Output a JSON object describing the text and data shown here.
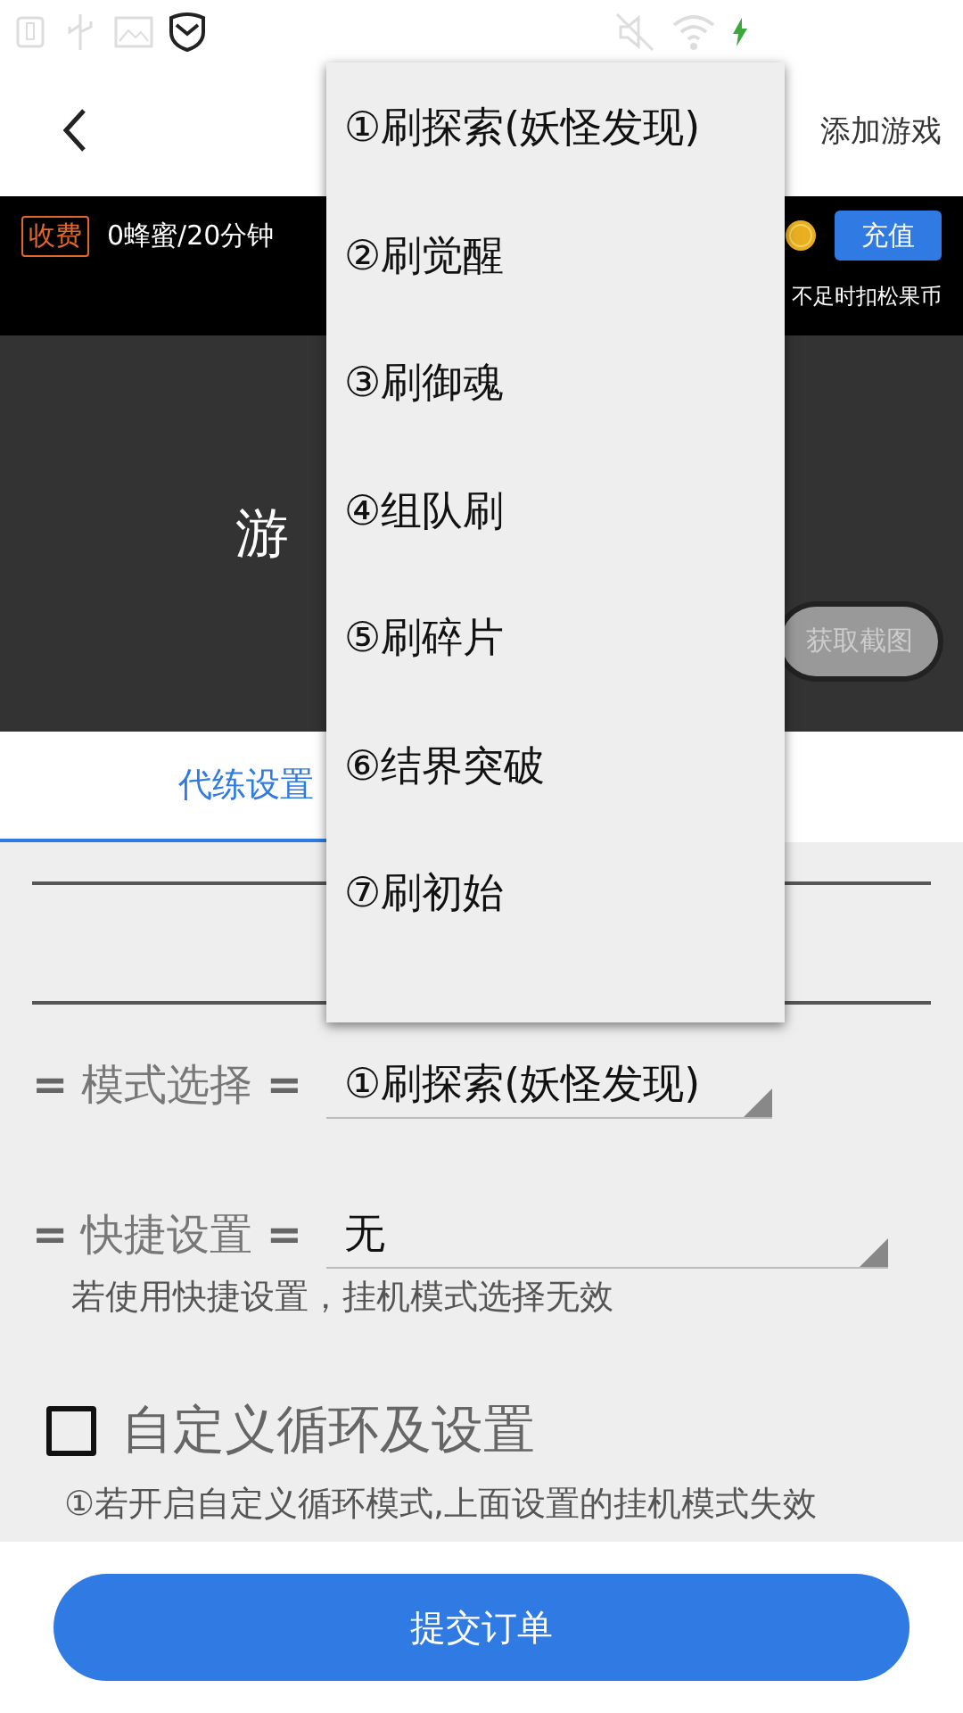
{
  "header": {
    "action": "添加游戏"
  },
  "fee_bar": {
    "tag": "收费",
    "rate": "0蜂蜜/20分钟",
    "recharge": "充值",
    "note": "不足时扣松果币"
  },
  "preview": {
    "title": "游",
    "capture_button": "获取截图"
  },
  "tabs": [
    {
      "label": "代练设置",
      "selected": true
    }
  ],
  "mode": {
    "label": "**=** 模式选择 **=**",
    "value": "①刷探索(妖怪发现)"
  },
  "quick": {
    "label": "**=** 快捷设置 **=**",
    "value": "无",
    "hint": "若使用快捷设置，挂机模式选择无效"
  },
  "custom_loop": {
    "label": "自定义循环及设置",
    "checked": false,
    "note": "①若开启自定义循环模式,上面设置的挂机模式失效"
  },
  "submit": "提交订单",
  "dropdown_menu": {
    "items": [
      "①刷探索(妖怪发现)",
      "②刷觉醒",
      "③刷御魂",
      "④组队刷",
      "⑤刷碎片",
      "⑥结界突破",
      "⑦刷初始"
    ]
  }
}
